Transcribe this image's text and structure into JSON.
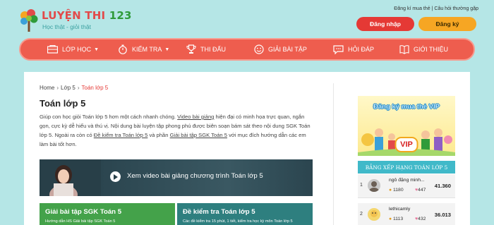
{
  "brand": {
    "name_part1": "LUYỆN THI",
    "name_part2": "123",
    "tagline": "Học thật - giỏi thật"
  },
  "header": {
    "link_buy_card": "Đăng kí mua thẻ",
    "link_separator": "|",
    "link_faq": "Câu hỏi thường gặp",
    "login_label": "Đăng nhập",
    "register_label": "Đăng ký"
  },
  "nav": {
    "items": [
      {
        "label": "LỚP HỌC",
        "icon": "classroom-icon",
        "has_dropdown": true
      },
      {
        "label": "KIỂM TRA",
        "icon": "stopwatch-icon",
        "has_dropdown": true
      },
      {
        "label": "THI ĐẤU",
        "icon": "trophy-icon",
        "has_dropdown": false
      },
      {
        "label": "GIẢI BÀI TẬP",
        "icon": "smiley-icon",
        "has_dropdown": false
      },
      {
        "label": "HỎI ĐÁP",
        "icon": "chat-icon",
        "has_dropdown": false
      },
      {
        "label": "GIỚI THIỆU",
        "icon": "book-icon",
        "has_dropdown": false
      }
    ]
  },
  "breadcrumb": {
    "home": "Home",
    "sep": "›",
    "level1": "Lớp 5",
    "current": "Toán lớp 5"
  },
  "page": {
    "title": "Toán lớp 5",
    "intro_1": "Giúp con học giỏi Toán lớp 5 hơn một cách nhanh chóng.",
    "intro_link_1": "Video bài giảng",
    "intro_2": "hiện đại có minh họa trực quan, ngắn gọn, cực kỳ dễ hiểu và thú vị. Nội dung bài luyện tập phong phú được biên soạn bám sát theo nội dung SGK Toán lớp 5. Ngoài ra còn có",
    "intro_link_2": "Đề kiểm tra Toán lớp 5",
    "intro_3": "và phần",
    "intro_link_3": "Giải bài tập SGK Toán 5",
    "intro_4": "với mục đích hướng dẫn các em làm bài tốt hơn."
  },
  "video": {
    "label": "Xem video bài giảng chương trình Toán lớp 5"
  },
  "cards": [
    {
      "title": "Giải bài tập SGK Toán 5",
      "subtitle": "Hướng dẫn HS Giải bài tập SGK Toán 5",
      "color": "#44a24a"
    },
    {
      "title": "Đề kiểm tra Toán lớp 5",
      "subtitle": "Các đề kiểm tra 15 phút, 1 tiết, kiểm tra học kỳ môn Toán lớp 5",
      "color": "#2e7f7f"
    }
  ],
  "sidebar": {
    "promo_title": "Đăng ký mua thẻ VIP",
    "promo_badge": "VIP",
    "ranking_title": "BẢNG XẾP HẠNG TOÁN LỚP 5",
    "ranking": [
      {
        "rank": "1",
        "name": "ngô đặng minh...",
        "coins": "1180",
        "hearts": "447",
        "score": "41.360"
      },
      {
        "rank": "2",
        "name": "lethicamly",
        "coins": "1113",
        "hearts": "432",
        "score": "36.013"
      }
    ]
  },
  "colors": {
    "background": "#b5e6e6",
    "nav": "#ee5d4e",
    "login": "#e53935",
    "register": "#f6a623",
    "ranking_header": "#40b9c9"
  }
}
